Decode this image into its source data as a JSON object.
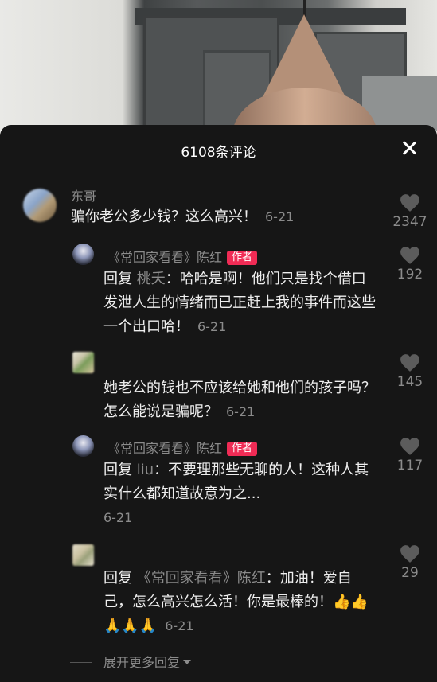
{
  "header": {
    "title": "6108条评论"
  },
  "comments": [
    {
      "name": "东哥",
      "text": "骗你老公多少钱？这么高兴！",
      "time": "6-21",
      "likes": "2347"
    },
    {
      "name": "《常回家看看》陈红",
      "badge": "作者",
      "reply_prefix": "回复",
      "reply_to": "桃夭",
      "text": "：哈哈是啊！他们只是找个借口发泄人生的情绪而已正赶上我的事件而这些一个出口哈！",
      "time": "6-21",
      "likes": "192"
    },
    {
      "name": "",
      "text": "她老公的钱也不应该给她和他们的孩子吗？怎么能说是骗呢？",
      "time": "6-21",
      "likes": "145"
    },
    {
      "name": "《常回家看看》陈红",
      "badge": "作者",
      "reply_prefix": "回复",
      "reply_to": "liu",
      "text": "：不要理那些无聊的人！这种人其实什么都知道故意为之...",
      "time": "6-21",
      "likes": "117"
    },
    {
      "name": "",
      "reply_prefix": "回复",
      "reply_to": "《常回家看看》陈红",
      "text": "：加油！爱自己，怎么高兴怎么活！你是最棒的！👍👍🙏🙏🙏",
      "time": "6-21",
      "likes": "29"
    }
  ],
  "footer": {
    "more_replies": "展开更多回复"
  },
  "colors": {
    "accent": "#f02b55",
    "background": "#161616",
    "muted": "#8b8b8b"
  }
}
